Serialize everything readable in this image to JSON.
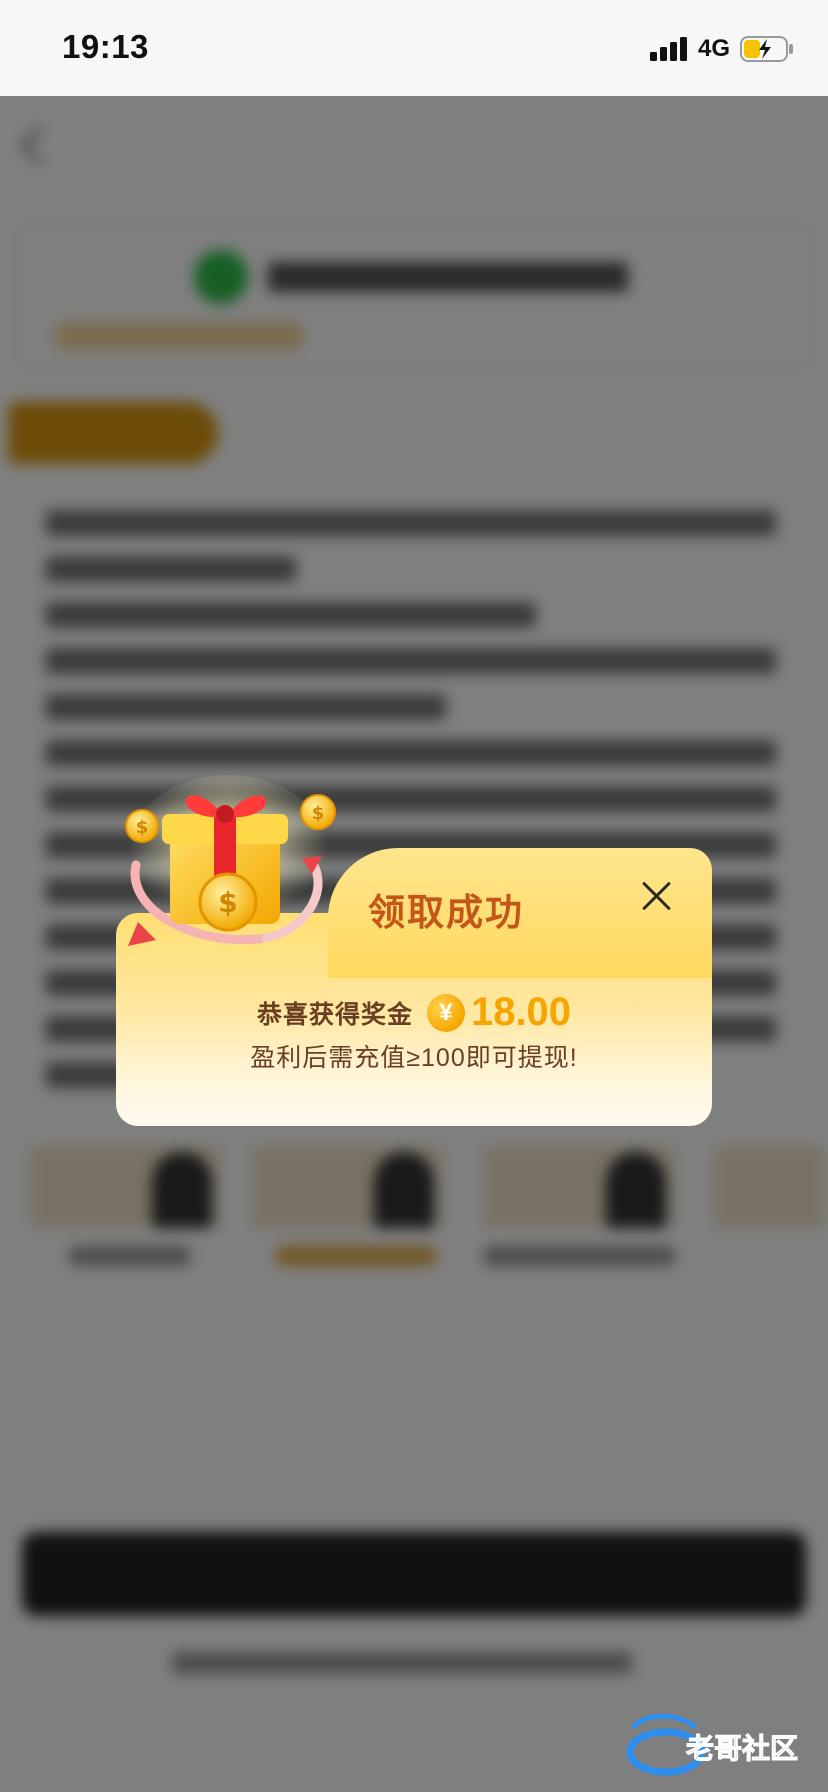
{
  "status_bar": {
    "time": "19:13",
    "network": "4G",
    "battery_icon": "battery-charging-icon",
    "signal_icon": "cellular-signal-icon"
  },
  "modal": {
    "title": "领取成功",
    "reward_prefix": "恭喜获得奖金",
    "currency_symbol": "¥",
    "amount": "18.00",
    "note": "盈利后需充值≥100即可提现!",
    "close_icon": "close-icon",
    "illustration_icon": "gift-box-with-coins-icon"
  },
  "watermark": {
    "text": "老哥社区",
    "icon": "dragon-logo-icon"
  },
  "colors": {
    "title": "#c5561a",
    "amount": "#f5a400",
    "body_text": "#6a3e22",
    "modal_top": "#ffdf72",
    "modal_bottom": "#fffaf0",
    "overlay": "rgba(0,0,0,0.5)"
  }
}
